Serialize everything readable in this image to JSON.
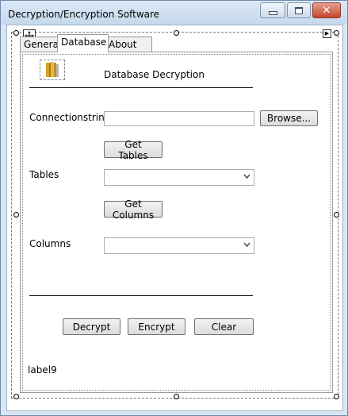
{
  "window": {
    "title": "Decryption/Encryption Software",
    "close_glyph": "✕"
  },
  "tabs": [
    {
      "label": "General"
    },
    {
      "label": "Database"
    },
    {
      "label": "About me"
    }
  ],
  "database_tab": {
    "icon": "database-icon",
    "header": "Database Decryption",
    "connection_label": "Connectionstring",
    "connection_value": "",
    "browse_button": "Browse...",
    "get_tables_button": "Get Tables",
    "tables_label": "Tables",
    "tables_value": "",
    "get_columns_button": "Get Columns",
    "columns_label": "Columns",
    "columns_value": "",
    "decrypt_button": "Decrypt",
    "encrypt_button": "Encrypt",
    "clear_button": "Clear",
    "status_label": "label9"
  },
  "colors": {
    "titlebar": "#c6d8ec",
    "close_button": "#c9452c"
  }
}
